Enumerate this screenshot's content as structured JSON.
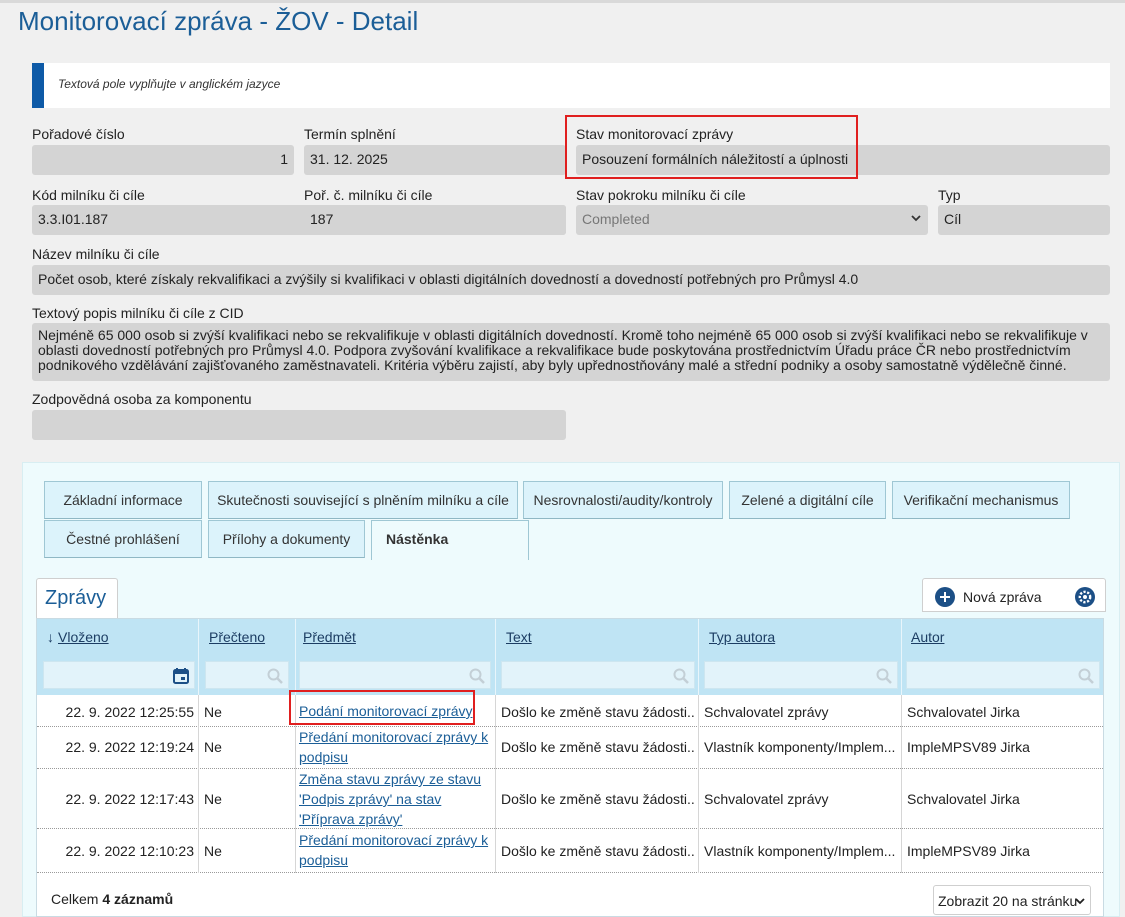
{
  "page": {
    "title": "Monitorovací zpráva - ŽOV - Detail",
    "notice": "Textová pole vyplňujte v anglickém jazyce"
  },
  "form": {
    "poradove_cislo": {
      "label": "Pořadové číslo",
      "value": "1"
    },
    "termin_splneni": {
      "label": "Termín splnění",
      "value": "31. 12. 2025"
    },
    "stav_zpravy": {
      "label": "Stav monitorovací zprávy",
      "value": "Posouzení formálních náležitostí a úplnosti"
    },
    "kod_milniku": {
      "label": "Kód milníku či cíle",
      "value": "3.3.I01.187"
    },
    "por_milniku": {
      "label": "Poř. č. milníku či cíle",
      "value": "187"
    },
    "stav_pokroku": {
      "label": "Stav pokroku milníku či cíle",
      "value": "Completed"
    },
    "typ": {
      "label": "Typ",
      "value": "Cíl"
    },
    "nazev": {
      "label": "Název milníku či cíle",
      "value": "Počet osob, které získaly rekvalifikaci a zvýšily si kvalifikaci v oblasti digitálních dovedností a dovedností potřebných pro Průmysl 4.0"
    },
    "popis": {
      "label": "Textový popis milníku či cíle z CID",
      "value": "Nejméně 65 000 osob si zvýší kvalifikaci nebo se rekvalifikuje v oblasti digitálních dovedností. Kromě toho nejméně 65 000 osob si zvýší kvalifikaci nebo se rekvalifikuje v oblasti dovedností potřebných pro Průmysl 4.0. Podpora zvyšování kvalifikace a rekvalifikace bude poskytována prostřednictvím Úřadu práce ČR nebo prostřednictvím podnikového vzdělávání zajišťovaného zaměstnavateli. Kritéria výběru zajistí, aby byly upřednostňovány malé a střední podniky a osoby samostatně výdělečně činné."
    },
    "odpovedna_osoba": {
      "label": "Zodpovědná osoba za komponentu",
      "value": ""
    }
  },
  "tabs": [
    {
      "label": "Základní informace"
    },
    {
      "label": "Skutečnosti související s plněním milníku a cíle"
    },
    {
      "label": "Nesrovnalosti/audity/kontroly"
    },
    {
      "label": "Zelené a digitální cíle"
    },
    {
      "label": "Verifikační mechanismus"
    },
    {
      "label": "Čestné prohlášení"
    },
    {
      "label": "Přílohy a dokumenty"
    },
    {
      "label": "Nástěnka"
    }
  ],
  "messages": {
    "tab_label": "Zprávy",
    "new_button": "Nová zpráva",
    "sort_arrow": "↓",
    "columns": [
      "Vloženo",
      "Přečteno",
      "Předmět",
      "Text",
      "Typ autora",
      "Autor"
    ],
    "rows": [
      {
        "vlozeno": "22. 9. 2022 12:25:55",
        "precteno": "Ne",
        "predmet": "Podání monitorovací zprávy",
        "text": "Došlo ke změně stavu žádosti...",
        "typ_autora": "Schvalovatel zprávy",
        "autor": "Schvalovatel Jirka"
      },
      {
        "vlozeno": "22. 9. 2022 12:19:24",
        "precteno": "Ne",
        "predmet": "Předání monitorovací zprávy k podpisu",
        "text": "Došlo ke změně stavu žádosti...",
        "typ_autora": "Vlastník komponenty/Implem...",
        "autor": "ImpleMPSV89 Jirka"
      },
      {
        "vlozeno": "22. 9. 2022 12:17:43",
        "precteno": "Ne",
        "predmet": "Změna stavu zprávy ze stavu 'Podpis zprávy' na stav 'Příprava zprávy'",
        "text": "Došlo ke změně stavu žádosti...",
        "typ_autora": "Schvalovatel zprávy",
        "autor": "Schvalovatel Jirka"
      },
      {
        "vlozeno": "22. 9. 2022 12:10:23",
        "precteno": "Ne",
        "predmet": "Předání monitorovací zprávy k podpisu",
        "text": "Došlo ke změně stavu žádosti...",
        "typ_autora": "Vlastník komponenty/Implem...",
        "autor": "ImpleMPSV89 Jirka"
      }
    ],
    "total_prefix": "Celkem ",
    "total_count": "4 záznamů",
    "page_size": "Zobrazit 20 na stránku"
  },
  "colors": {
    "title": "#1b5e97",
    "accent": "#0e5aa7",
    "highlight": "#e01f1f",
    "header": "#bfe4f4"
  }
}
